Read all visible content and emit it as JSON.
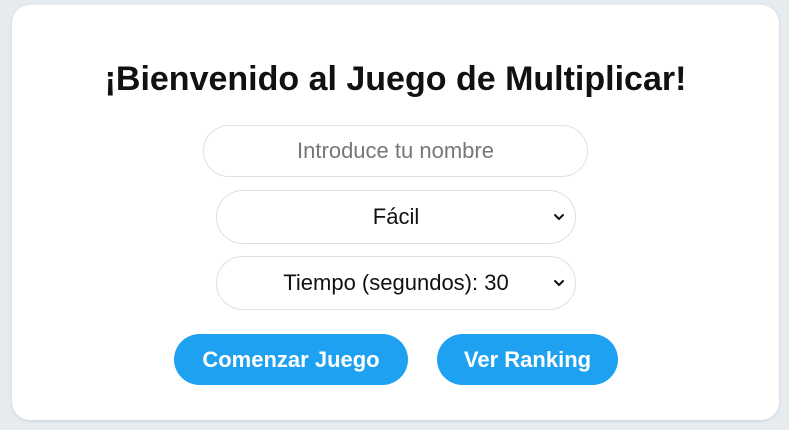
{
  "title": "¡Bienvenido al Juego de Multiplicar!",
  "name_input": {
    "value": "",
    "placeholder": "Introduce tu nombre"
  },
  "difficulty_select": {
    "selected": "Fácil",
    "icon": "chevron-down-icon"
  },
  "time_select": {
    "selected": "Tiempo (segundos): 30",
    "icon": "chevron-down-icon"
  },
  "buttons": {
    "start_label": "Comenzar Juego",
    "ranking_label": "Ver Ranking"
  },
  "colors": {
    "accent": "#1fa1f2",
    "background": "#e6ebf0",
    "card": "#ffffff"
  }
}
